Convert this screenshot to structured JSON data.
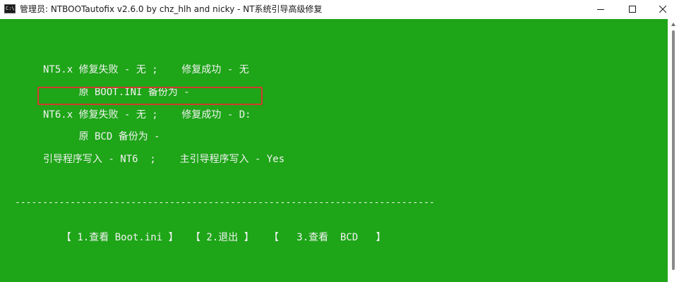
{
  "window": {
    "title": "管理员:  NTBOOTautofix v2.6.0 by chz_hlh and nicky - NT系统引导高级修复",
    "icon": "console-icon",
    "icon_text": "C:\\",
    "minimize_icon": "minimize-icon",
    "maximize_icon": "maximize-icon",
    "close_icon": "close-icon"
  },
  "console": {
    "background": "#1ea518",
    "text_color": "#f2f2f2",
    "highlight_color": "#d23a2e",
    "lines": [
      "NT5.x 修复失败 - 无 ;    修复成功 - 无",
      "      原 BOOT.INI 备份为 -",
      "NT6.x 修复失败 - 无 ;    修复成功 - D:",
      "      原 BCD 备份为 -",
      "引导程序写入 - NT6  ;    主引导程序写入 - Yes"
    ],
    "separator": "----------------------------------------------------------------------------",
    "menu": {
      "option1": "【 1.查看 Boot.ini 】",
      "option2": "【 2.退出 】",
      "option3": "【   3.查看  BCD   】"
    }
  }
}
